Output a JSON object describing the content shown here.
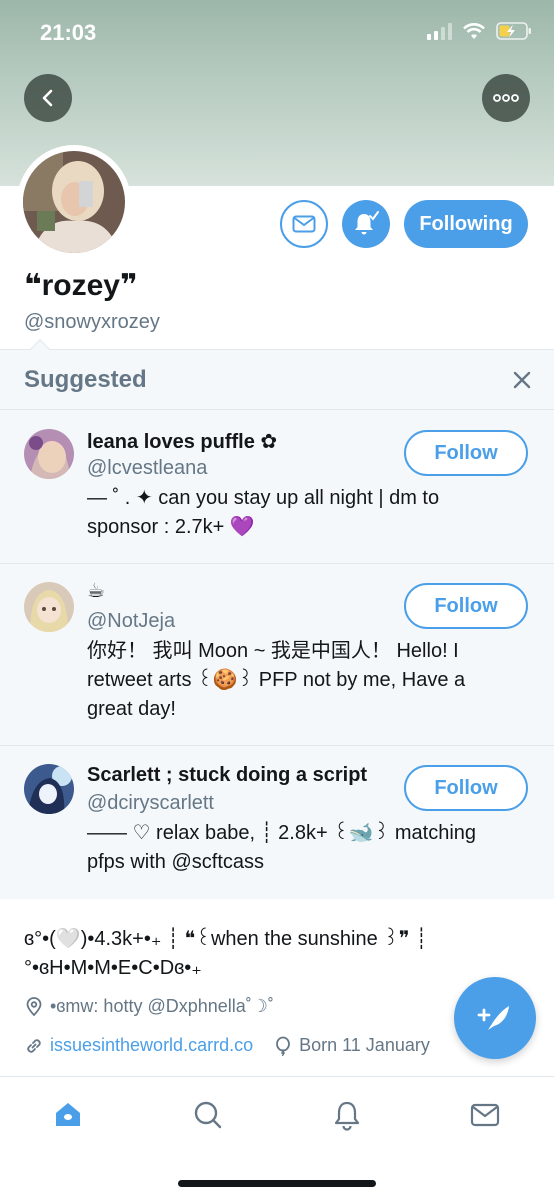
{
  "status_bar": {
    "time": "21:03"
  },
  "profile": {
    "display_name": "❝rozey❞",
    "handle": "@snowyxrozey",
    "following_label": "Following",
    "bio": "ɞ°•(🤍)•4.3k+•₊ ┊ ❝꒰when the sunshine ꒱❞ ┊ °•ɞH•M•M•E•C•Dɞ•₊",
    "location": "•ɞmw: hotty @Dxphnella˚☽˚",
    "website": "issuesintheworld.carrd.co",
    "birthday": "Born 11 January"
  },
  "suggested": {
    "title": "Suggested",
    "follow_label": "Follow",
    "items": [
      {
        "name": "leana loves puffle ✿",
        "handle": "@lcvestleana",
        "bio": "— ˚ . ✦ can you stay up all night | dm to sponsor : 2.7k+ 💜"
      },
      {
        "name": "☕",
        "handle": "@NotJeja",
        "bio": "你好！ 我叫 Moon ~ 我是中国人！ Hello! I retweet arts ꒰🍪꒱ PFP not by me, Have a great day!"
      },
      {
        "name": "Scarlett ; stuck doing a script",
        "handle": "@dciryscarlett",
        "bio": "—— ♡ relax babe, ┊ 2.8k+ ꒰🐋꒱ matching pfps with @scftcass"
      }
    ]
  },
  "colors": {
    "accent": "#4a9fe8",
    "muted_text": "#657786",
    "panel_bg": "#f5f8fa"
  },
  "tabs": [
    "home-icon",
    "search-icon",
    "notifications-icon",
    "messages-icon"
  ]
}
